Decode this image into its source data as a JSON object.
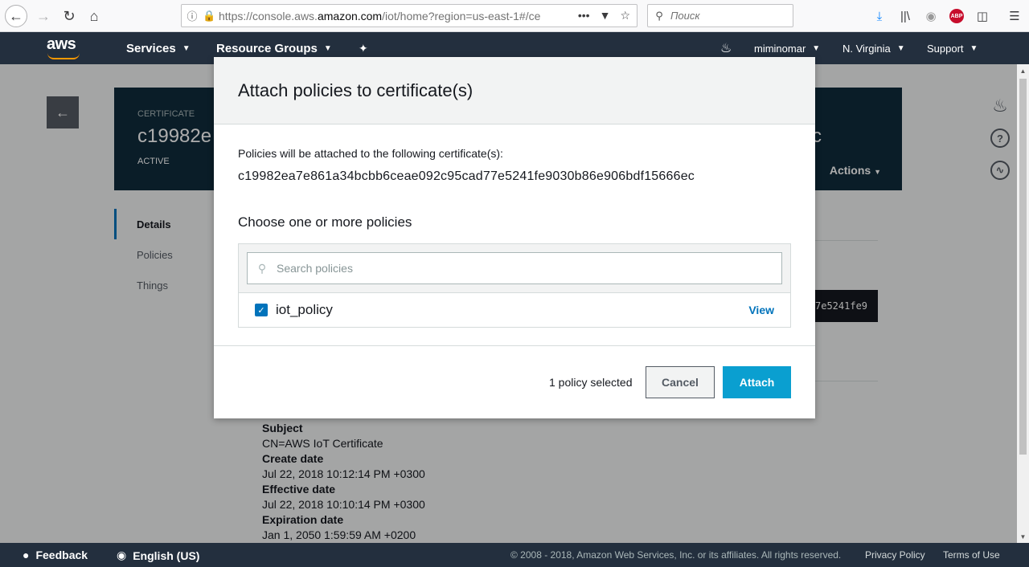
{
  "browser": {
    "url_prefix": "https://console.aws.",
    "url_domain": "amazon.com",
    "url_suffix": "/iot/home?region=us-east-1#/ce",
    "search_placeholder": "Поиск",
    "abp_label": "ABP"
  },
  "aws_nav": {
    "logo": "aws",
    "services": "Services",
    "resource_groups": "Resource Groups",
    "user": "miminomar",
    "region": "N. Virginia",
    "support": "Support"
  },
  "page": {
    "hero_label": "CERTIFICATE",
    "hero_title": "c19982e",
    "hero_status": "ACTIVE",
    "hero_title_tail": "c",
    "actions": "Actions",
    "side_menu": [
      "Details",
      "Policies",
      "Things"
    ],
    "arn_fragment": "7e5241fe9",
    "details": [
      {
        "key": "Subject",
        "value": "CN=AWS IoT Certificate"
      },
      {
        "key": "Create date",
        "value": "Jul 22, 2018 10:12:14 PM +0300"
      },
      {
        "key": "Effective date",
        "value": "Jul 22, 2018 10:10:14 PM +0300"
      },
      {
        "key": "Expiration date",
        "value": "Jan 1, 2050 1:59:59 AM +0200"
      }
    ]
  },
  "modal": {
    "title": "Attach policies to certificate(s)",
    "intro": "Policies will be attached to the following certificate(s):",
    "certificate_id": "c19982ea7e861a34bcbb6ceae092c95cad77e5241fe9030b86e906bdf15666ec",
    "choose_heading": "Choose one or more policies",
    "search_placeholder": "Search policies",
    "policies": [
      {
        "name": "iot_policy",
        "checked": true,
        "view_label": "View"
      }
    ],
    "selected_count": "1 policy selected",
    "cancel_label": "Cancel",
    "attach_label": "Attach"
  },
  "footer": {
    "feedback": "Feedback",
    "language": "English (US)",
    "copyright": "© 2008 - 2018, Amazon Web Services, Inc. or its affiliates. All rights reserved.",
    "privacy": "Privacy Policy",
    "terms": "Terms of Use"
  },
  "colors": {
    "nav_bg": "#232f3e",
    "accent_blue": "#0073bb",
    "attach_button": "#0a9fd0",
    "hero_bg": "#0f2b3c"
  }
}
